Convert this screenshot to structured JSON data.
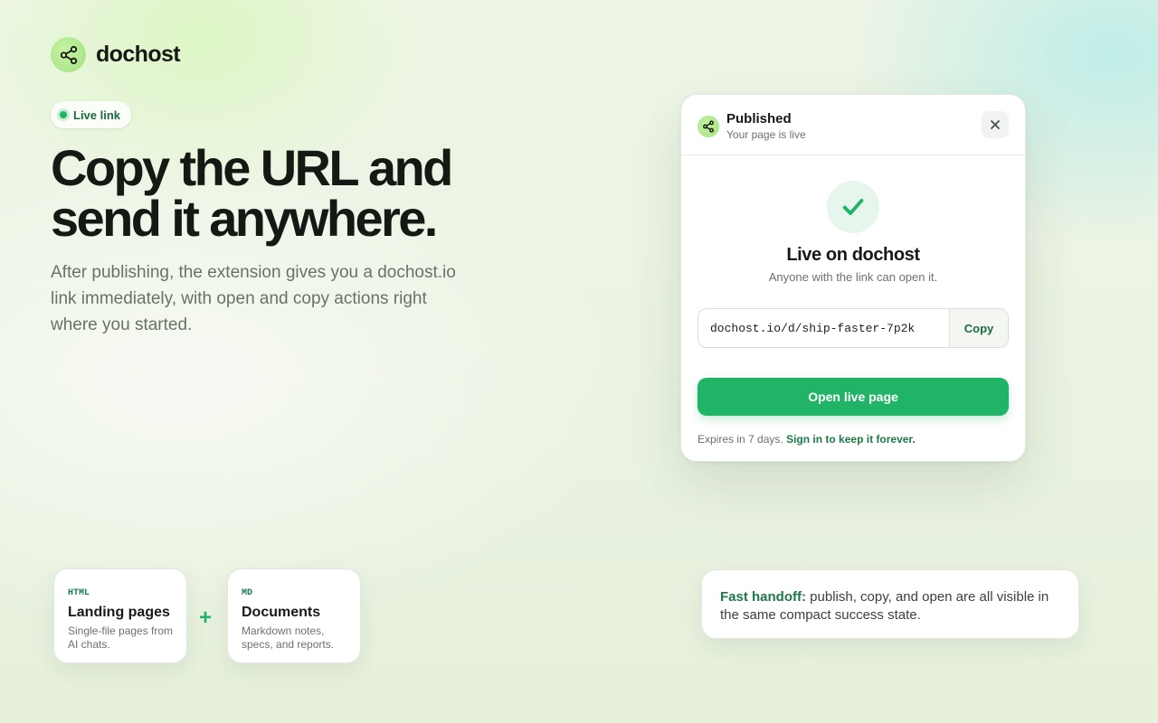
{
  "brand": {
    "name": "dochost",
    "icon": "share-icon"
  },
  "badge": {
    "label": "Live link",
    "icon": "live-dot-icon"
  },
  "hero": {
    "headline_line1": "Copy the URL and",
    "headline_line2": "send it anywhere.",
    "subtext": "After publishing, the extension gives you a dochost.io link immediately, with open and copy actions right where you started."
  },
  "dialog": {
    "header_title": "Published",
    "header_subtitle": "Your page is live",
    "header_icon": "share-icon",
    "close_icon": "close-icon",
    "status_icon": "check-icon",
    "status_title": "Live on dochost",
    "status_subtitle": "Anyone with the link can open it.",
    "url_value": "dochost.io/d/ship-faster-7p2k",
    "copy_label": "Copy",
    "open_label": "Open live page",
    "expires_text": "Expires in 7 days.",
    "signin_label": "Sign in to keep it forever."
  },
  "formats": [
    {
      "tag": "HTML",
      "title": "Landing pages",
      "desc": "Single-file pages from AI chats."
    },
    {
      "tag": "MD",
      "title": "Documents",
      "desc": "Markdown notes, specs, and reports."
    }
  ],
  "plus_symbol": "+",
  "callout": {
    "lead": "Fast handoff:",
    "text": " publish, copy, and open are all visible in the same compact success state."
  },
  "colors": {
    "accent": "#22b466",
    "accent_dark": "#1d7a48",
    "brand_mark": "#9ee27f",
    "text": "#141914",
    "muted": "#6b726a"
  }
}
